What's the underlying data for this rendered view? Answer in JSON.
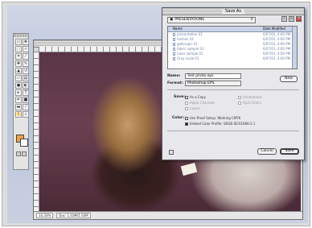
{
  "dialog": {
    "title": "Save As",
    "folder": "PRESENTATIONS",
    "list_header": {
      "name": "Name",
      "date": "Date Modified"
    },
    "files": [
      {
        "name": "presentation 01",
        "date": "6/07/01, 4:00 PM"
      },
      {
        "name": "fashion 01",
        "date": "6/07/01, 4:00 PM"
      },
      {
        "name": "gallerypic 01",
        "date": "6/07/01, 4:00 PM"
      },
      {
        "name": "fabric sample 01",
        "date": "6/07/01, 4:00 PM"
      },
      {
        "name": "Color sample 01",
        "date": "6/07/01, 4:00 PM"
      },
      {
        "name": "Gray scale 01",
        "date": "6/07/01, 4:00 PM"
      }
    ],
    "name_label": "Name:",
    "name_value": "Test photo.eps",
    "format_label": "Format:",
    "format_value": "Photoshop EPS",
    "new_button": "New",
    "save_label": "Save:",
    "save_options": [
      {
        "label": "As a Copy",
        "checked": false,
        "enabled": true
      },
      {
        "label": "Annotations",
        "checked": false,
        "enabled": false
      },
      {
        "label": "Alpha Channels",
        "checked": false,
        "enabled": false
      },
      {
        "label": "Spot Colors",
        "checked": false,
        "enabled": false
      },
      {
        "label": "Layers",
        "checked": false,
        "enabled": false
      }
    ],
    "color_label": "Color:",
    "color_options": [
      {
        "label": "Use Proof Setup: Working CMYK",
        "checked": false
      },
      {
        "label": "Embed Color Profile: SRGB IEC61966-2.1",
        "checked": true
      }
    ],
    "cancel_button": "Cancel",
    "save_button": "Save"
  },
  "document": {
    "status": [
      "33.33%",
      "Doc: 1.03M/1.03M"
    ]
  },
  "colors": {
    "foreground_swatch": "#f0a040",
    "background_swatch": "#ffffff",
    "dialog_accent": "#c9d2e6"
  }
}
